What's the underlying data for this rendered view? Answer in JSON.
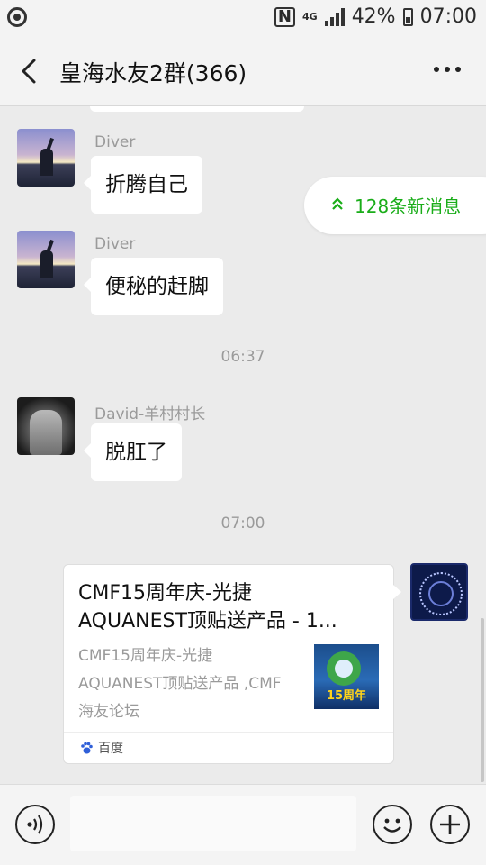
{
  "status_bar": {
    "nfc": "N",
    "network": "4G",
    "battery": "42%",
    "time": "07:00"
  },
  "header": {
    "title": "皇海水友2群(366)"
  },
  "new_messages": {
    "label": "128条新消息"
  },
  "messages": [
    {
      "sender": "Diver",
      "text": "折腾自己"
    },
    {
      "sender": "Diver",
      "text": "便秘的赶脚"
    },
    {
      "time": "06:37"
    },
    {
      "sender": "David-羊村村长",
      "text": "脱肛了"
    },
    {
      "time": "07:00"
    }
  ],
  "shared_card": {
    "title_line1": "CMF15周年庆-光捷",
    "title_line2": "AQUANEST顶贴送产品 - 1...",
    "desc_line1": "CMF15周年庆-光捷",
    "desc_line2": "AQUANEST顶贴送产品 ,CMF",
    "desc_line3": "海友论坛",
    "thumb_badge": "15周年",
    "source": "百度"
  },
  "colors": {
    "accent": "#1aad19",
    "chat_bg": "#ebebeb",
    "bar_bg": "#f3f3f3"
  },
  "icons": {
    "back": "back-arrow-icon",
    "more": "more-dots-icon",
    "voice": "voice-icon",
    "emoji": "emoji-icon",
    "plus": "plus-icon",
    "new_msg_arrow": "double-chevron-up-icon",
    "source": "baidu-paw-icon"
  }
}
